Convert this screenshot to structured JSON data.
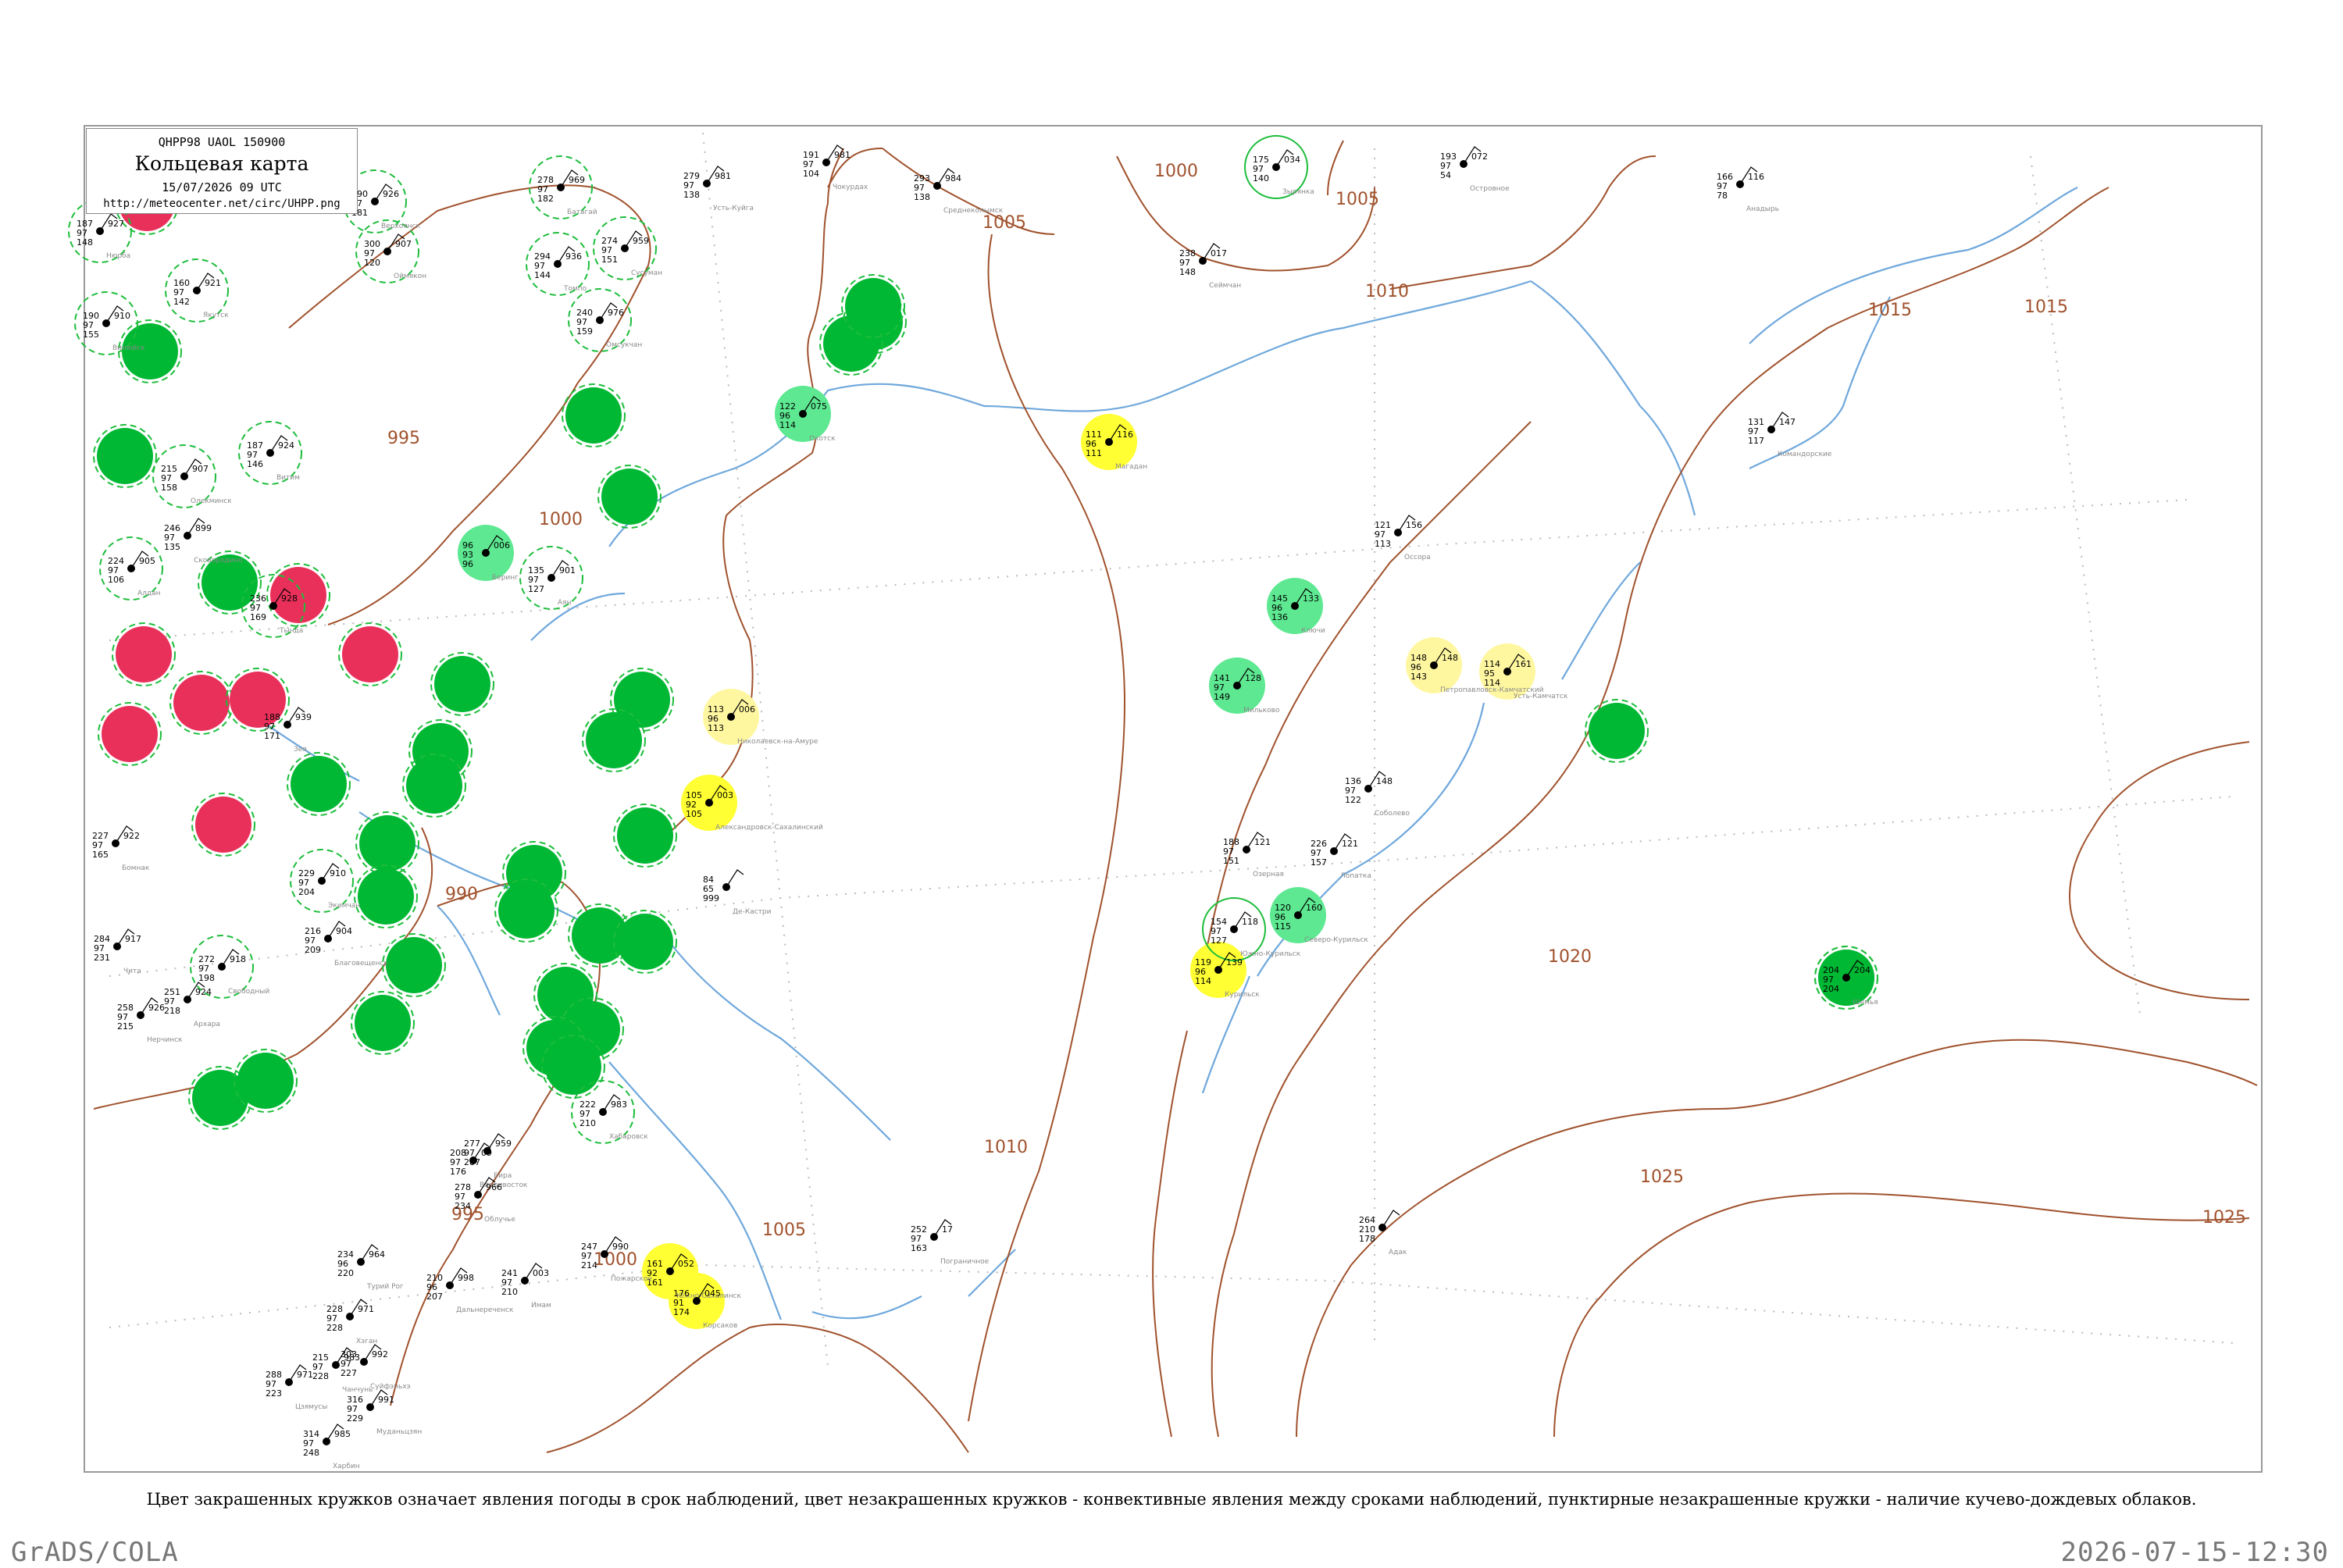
{
  "header": {
    "code": "QHPP98  UAOL  150900",
    "title": "Кольцевая карта",
    "datetime": "15/07/2026 09 UTC",
    "url": "http://meteocenter.net/circ/UHPP.png"
  },
  "caption": "Цвет закрашенных кружков означает явления погоды в срок наблюдений, цвет незакрашенных кружков - конвективные явления между сроками наблюдений, пунктирные незакрашенные кружки - наличие кучево-дождевых облаков.",
  "footer": {
    "left": "GrADS/COLA",
    "right": "2026-07-15-12:30"
  },
  "colors": {
    "isobar": "#a0522d",
    "water": "#6fa8dc",
    "fill_green": "#00b833",
    "fill_lightgreen": "#5de891",
    "fill_red": "#e8305a",
    "fill_yellow": "#ffff33",
    "fill_paleyellow": "#fff7a0",
    "ring_green": "#1ebd3c"
  },
  "isobar_labels": [
    "995",
    "1000",
    "1005",
    "1010",
    "1015",
    "1020",
    "1025",
    "990"
  ],
  "stations": [
    {
      "name": "Верхоянск",
      "values": [
        "290",
        "97",
        "181",
        "926"
      ]
    },
    {
      "name": "Батагай",
      "values": [
        "278",
        "97",
        "182",
        "969"
      ]
    },
    {
      "name": "Усть-Куйга",
      "values": [
        "279",
        "97",
        "138",
        "981"
      ]
    },
    {
      "name": "Чокурдах",
      "values": [
        "191",
        "97",
        "104",
        "981"
      ]
    },
    {
      "name": "Среднеколымск",
      "values": [
        "293",
        "97",
        "138",
        "984"
      ]
    },
    {
      "name": "Зырянка",
      "values": [
        "175",
        "97",
        "140",
        "034"
      ]
    },
    {
      "name": "Островное",
      "values": [
        "193",
        "97",
        "54",
        "072"
      ]
    },
    {
      "name": "Анадырь",
      "values": [
        "166",
        "97",
        "78",
        "116"
      ]
    },
    {
      "name": "Сеймчан",
      "values": [
        "238",
        "97",
        "148",
        "017"
      ]
    },
    {
      "name": "Оймякон",
      "values": [
        "300",
        "97",
        "120",
        "907"
      ]
    },
    {
      "name": "Томпо",
      "values": [
        "294",
        "97",
        "144",
        "936"
      ]
    },
    {
      "name": "Сусуман",
      "values": [
        "274",
        "97",
        "151",
        "959"
      ]
    },
    {
      "name": "Омсукчан",
      "values": [
        "240",
        "97",
        "159",
        "976"
      ]
    },
    {
      "name": "Магадан",
      "values": [
        "111",
        "96",
        "111",
        "116"
      ]
    },
    {
      "name": "Охотск",
      "values": [
        "122",
        "96",
        "114",
        "075"
      ]
    },
    {
      "name": "Аян",
      "values": [
        "135",
        "97",
        "127",
        "901"
      ]
    },
    {
      "name": "Николаевск-на-Амуре",
      "values": [
        "113",
        "96",
        "113",
        "006"
      ]
    },
    {
      "name": "Александровск-Сахалинский",
      "values": [
        "105",
        "92",
        "105",
        "003"
      ]
    },
    {
      "name": "Южно-Сахалинск",
      "values": [
        "161",
        "92",
        "161",
        "052"
      ]
    },
    {
      "name": "Корсаков",
      "values": [
        "176",
        "91",
        "174",
        "045"
      ]
    },
    {
      "name": "Петропавловск-Камчатский",
      "values": [
        "148",
        "96",
        "143",
        "148"
      ]
    },
    {
      "name": "Усть-Камчатск",
      "values": [
        "114",
        "95",
        "114",
        "161"
      ]
    },
    {
      "name": "Северо-Курильск",
      "values": [
        "120",
        "96",
        "115",
        "160"
      ]
    },
    {
      "name": "Курильск",
      "values": [
        "119",
        "96",
        "114",
        "139"
      ]
    },
    {
      "name": "Южно-Курильск",
      "values": [
        "154",
        "97",
        "127",
        "118"
      ]
    },
    {
      "name": "Хабаровск",
      "values": [
        "222",
        "97",
        "210",
        "983"
      ]
    },
    {
      "name": "Владивосток",
      "values": [
        "208",
        "97",
        "176",
        "09"
      ]
    },
    {
      "name": "Командорские",
      "values": [
        "131",
        "97",
        "117",
        "147"
      ]
    },
    {
      "name": "Ключи",
      "values": [
        "145",
        "96",
        "136",
        "133"
      ]
    },
    {
      "name": "Мильково",
      "values": [
        "141",
        "97",
        "149",
        "128"
      ]
    },
    {
      "name": "Соболево",
      "values": [
        "136",
        "97",
        "122",
        "148"
      ]
    },
    {
      "name": "Оссора",
      "values": [
        "121",
        "97",
        "113",
        "156"
      ]
    },
    {
      "name": "Озерная",
      "values": [
        "188",
        "97",
        "151",
        "121"
      ]
    },
    {
      "name": "Лопатка",
      "values": [
        "226",
        "97",
        "157",
        "121"
      ]
    },
    {
      "name": "Адак",
      "values": [
        "264",
        "210",
        "178"
      ]
    },
    {
      "name": "Шемья",
      "values": [
        "204",
        "97",
        "204",
        "204"
      ]
    },
    {
      "name": "Беринг",
      "values": [
        "96",
        "93",
        "96",
        "006"
      ]
    },
    {
      "name": "Де-Кастри",
      "values": [
        "84",
        "65",
        "999"
      ]
    },
    {
      "name": "Пограничное",
      "values": [
        "252",
        "97",
        "163",
        "17"
      ]
    },
    {
      "name": "Сковородино",
      "values": [
        "246",
        "97",
        "135",
        "899"
      ]
    },
    {
      "name": "Тында",
      "values": [
        "236",
        "97",
        "169",
        "928"
      ]
    },
    {
      "name": "Зея",
      "values": [
        "188",
        "97",
        "171",
        "939"
      ]
    },
    {
      "name": "Благовещенск",
      "values": [
        "216",
        "97",
        "209",
        "904"
      ]
    },
    {
      "name": "Чита",
      "values": [
        "284",
        "97",
        "231",
        "917"
      ]
    },
    {
      "name": "Нерчинск",
      "values": [
        "258",
        "97",
        "215",
        "926"
      ]
    },
    {
      "name": "Олекминск",
      "values": [
        "215",
        "97",
        "158",
        "907"
      ]
    },
    {
      "name": "Алдан",
      "values": [
        "224",
        "97",
        "106",
        "905"
      ]
    },
    {
      "name": "Витим",
      "values": [
        "187",
        "97",
        "146",
        "924"
      ]
    },
    {
      "name": "Якутск",
      "values": [
        "160",
        "97",
        "142",
        "921"
      ]
    },
    {
      "name": "Вилюйск",
      "values": [
        "190",
        "97",
        "155",
        "910"
      ]
    },
    {
      "name": "Нюрба",
      "values": [
        "187",
        "97",
        "148",
        "927"
      ]
    },
    {
      "name": "Бомнак",
      "values": [
        "227",
        "97",
        "165",
        "922"
      ]
    },
    {
      "name": "Экимчан",
      "values": [
        "229",
        "97",
        "204",
        "910"
      ]
    },
    {
      "name": "Свободный",
      "values": [
        "272",
        "97",
        "198",
        "918"
      ]
    },
    {
      "name": "Архара",
      "values": [
        "251",
        "97",
        "218",
        "924"
      ]
    },
    {
      "name": "Бира",
      "values": [
        "277",
        "97",
        "287",
        "959"
      ]
    },
    {
      "name": "Облучье",
      "values": [
        "278",
        "97",
        "234",
        "966"
      ]
    },
    {
      "name": "Имам",
      "values": [
        "241",
        "97",
        "210",
        "003"
      ]
    },
    {
      "name": "Пожарское",
      "values": [
        "247",
        "97",
        "214",
        "990"
      ]
    },
    {
      "name": "Дальнереченск",
      "values": [
        "210",
        "96",
        "207",
        "998"
      ]
    },
    {
      "name": "Турий Рог",
      "values": [
        "234",
        "96",
        "220",
        "964"
      ]
    },
    {
      "name": "Хэган",
      "values": [
        "228",
        "97",
        "228",
        "971"
      ]
    },
    {
      "name": "Цзямусы",
      "values": [
        "288",
        "97",
        "223",
        "971"
      ]
    },
    {
      "name": "Харбин",
      "values": [
        "314",
        "97",
        "248",
        "985"
      ]
    },
    {
      "name": "Муданьцзян",
      "values": [
        "316",
        "97",
        "229",
        "991"
      ]
    },
    {
      "name": "Суйфэньхэ",
      "values": [
        "303",
        "97",
        "227",
        "992"
      ]
    },
    {
      "name": "Чанчунь",
      "values": [
        "215",
        "97",
        "228",
        "983"
      ]
    }
  ]
}
